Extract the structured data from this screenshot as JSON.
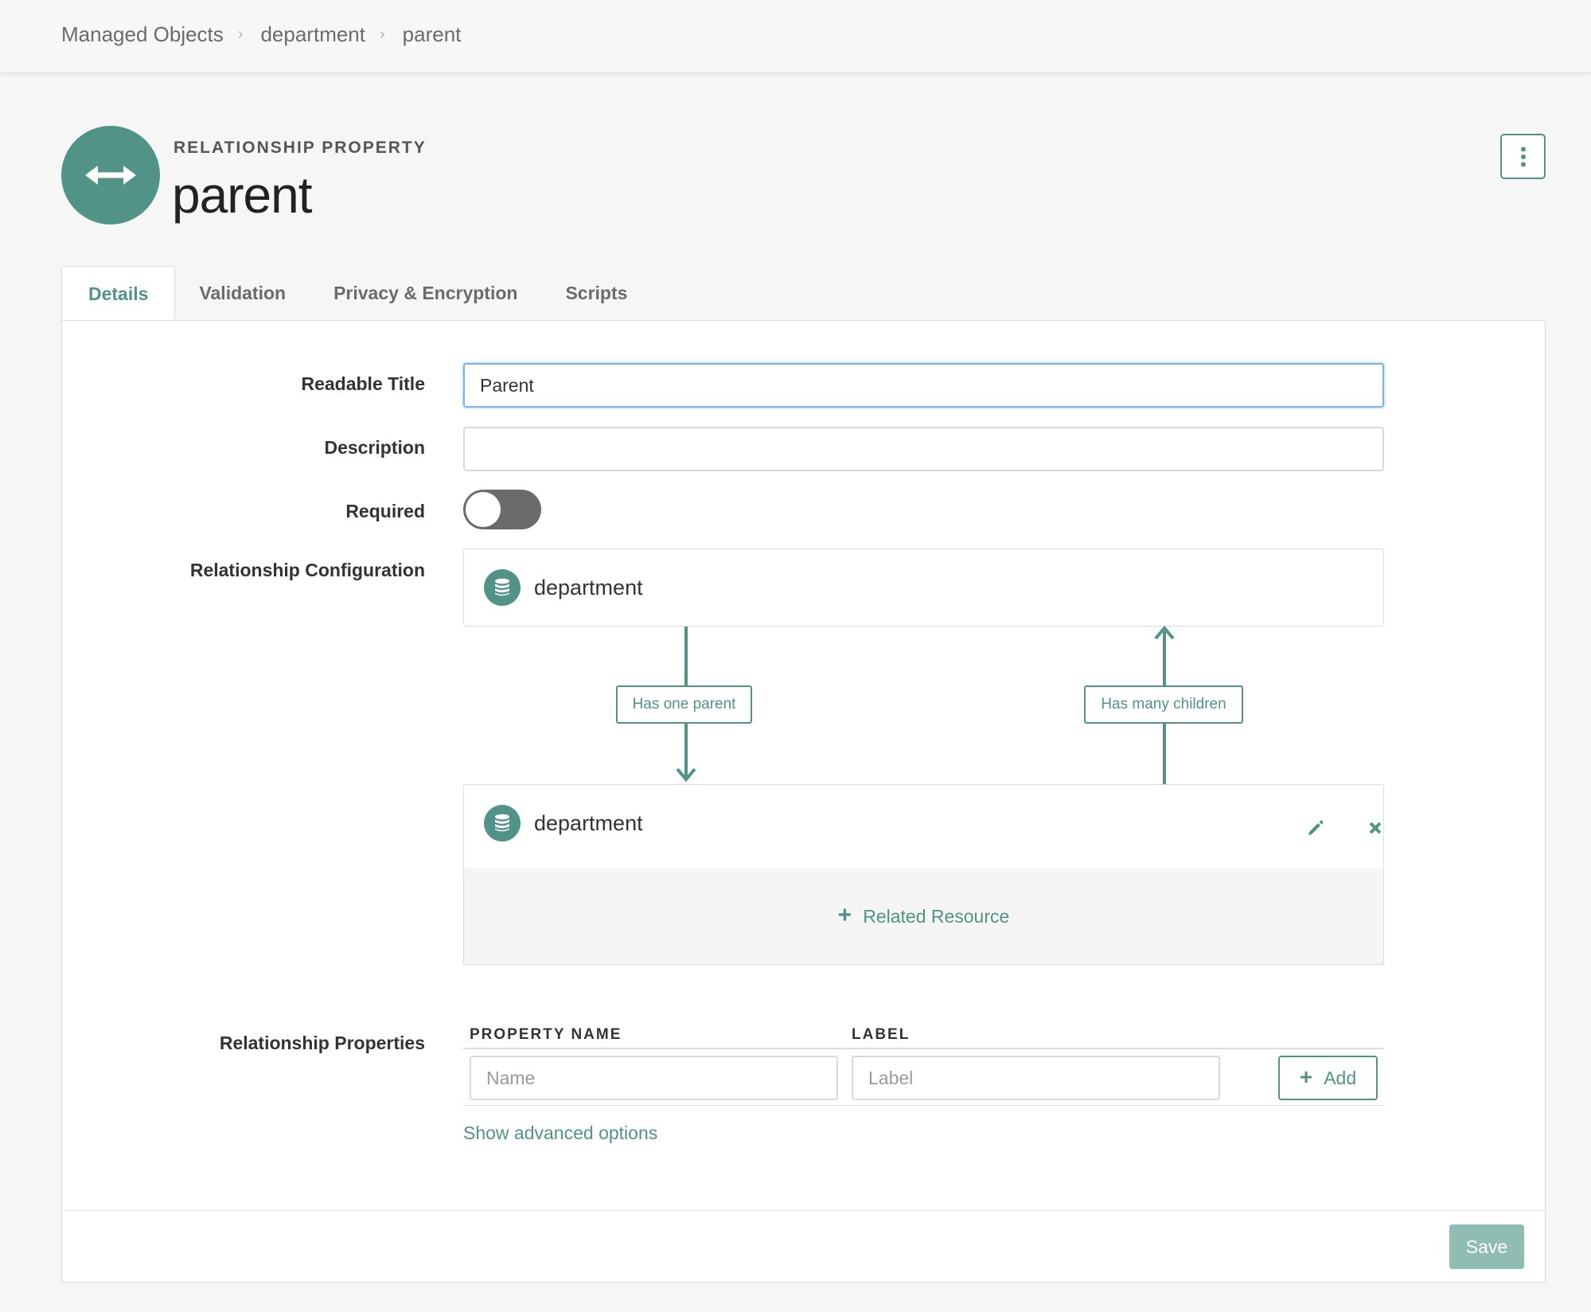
{
  "breadcrumb": [
    "Managed Objects",
    "department",
    "parent"
  ],
  "header": {
    "eyebrow": "RELATIONSHIP PROPERTY",
    "title": "parent",
    "hero_icon": "bidirectional-arrow-icon",
    "menu_icon": "vertical-ellipsis-icon"
  },
  "tabs": [
    {
      "label": "Details",
      "active": true
    },
    {
      "label": "Validation",
      "active": false
    },
    {
      "label": "Privacy & Encryption",
      "active": false
    },
    {
      "label": "Scripts",
      "active": false
    }
  ],
  "form": {
    "readable_title_label": "Readable Title",
    "readable_title_value": "Parent",
    "description_label": "Description",
    "description_value": "",
    "required_label": "Required",
    "required_on": false,
    "relationship_config_label": "Relationship Configuration",
    "relationship_properties_label": "Relationship Properties"
  },
  "relationship": {
    "source": {
      "name": "department",
      "icon": "database-icon"
    },
    "target": {
      "name": "department",
      "icon": "database-icon"
    },
    "forward_label": "Has one parent",
    "reverse_label": "Has many children",
    "add_related_label": "Related Resource"
  },
  "properties_table": {
    "columns": [
      "PROPERTY NAME",
      "LABEL"
    ],
    "name_placeholder": "Name",
    "label_placeholder": "Label",
    "add_label": "Add"
  },
  "advanced_link": "Show advanced options",
  "save_label": "Save",
  "colors": {
    "accent": "#519387",
    "accent_disabled": "#8fbdb3",
    "focus": "#7db2e6"
  }
}
